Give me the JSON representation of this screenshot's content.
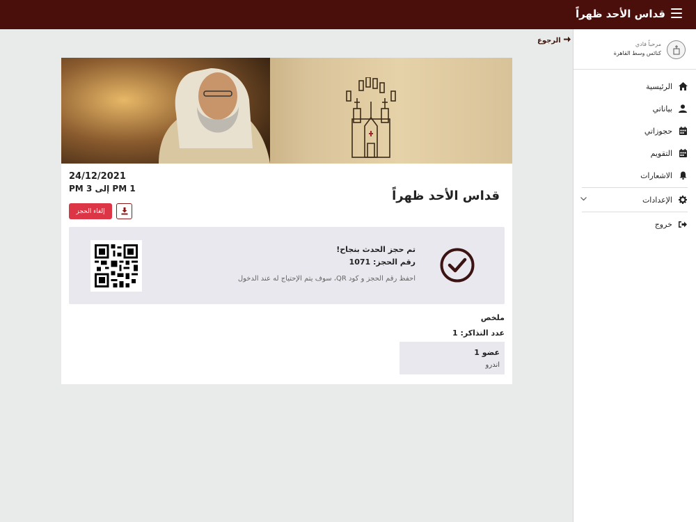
{
  "header": {
    "title": "قداس الأحد ظهراً",
    "menu_icon": "hamburger-icon"
  },
  "sidebar": {
    "greeting": "مرحباً فادي",
    "church": "كنائس وسط القاهرة",
    "items": [
      {
        "label": "الرئيسية",
        "icon": "home-icon"
      },
      {
        "label": "بياناتي",
        "icon": "user-icon"
      },
      {
        "label": "حجوزاتي",
        "icon": "calendar-icon"
      },
      {
        "label": "التقويم",
        "icon": "calendar-icon"
      },
      {
        "label": "الاشعارات",
        "icon": "bell-icon"
      },
      {
        "label": "الإعدادات",
        "icon": "gear-icon"
      },
      {
        "label": "خروج",
        "icon": "logout-icon"
      }
    ]
  },
  "back": {
    "label": "الرجوع"
  },
  "event": {
    "title": "قداس الأحد ظهراً",
    "date": "24/12/2021",
    "time": "1 PM إلى 3 PM",
    "cancel_label": "إلغاء الحجز"
  },
  "success": {
    "line1": "تم حجز الحدث بنجاح!",
    "line2": "رقم الحجز: 1071",
    "line3": "احفظ رقم الحجز و كود QR، سوف يتم الإحتياج له عند الدخول"
  },
  "summary": {
    "title": "ملخص",
    "tickets": "عدد التذاكر: 1",
    "member_title": "عضو 1",
    "member_name": "اندرو"
  },
  "colors": {
    "brand": "#4a0e0b",
    "danger": "#dc3545",
    "box": "#e9e8ee"
  }
}
